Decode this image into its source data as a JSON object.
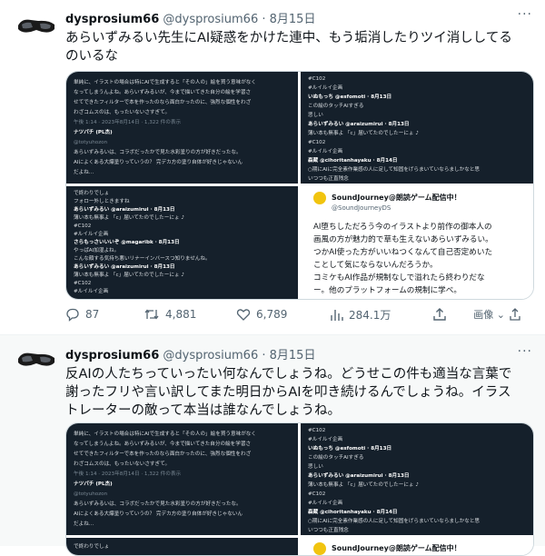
{
  "tweets": [
    {
      "display_name": "dysprosium66",
      "handle": "@dysprosium66",
      "dot": "·",
      "date": "8月15日",
      "more": "···",
      "text_lines": [
        "あらいずみるい先生にAI疑惑をかけた連中、もう垢消したりツイ消ししてる",
        "のいるな"
      ],
      "media": {
        "top_left": [
          {
            "t": "単純に、イラストの場合は特にAIで生成すると「その人の」絵を買う意味がなく",
            "c": ""
          },
          {
            "t": "なってしまうんよね。あらいずみるいが、今まで描いてきた自分の絵を学習さ",
            "c": ""
          },
          {
            "t": "せてできたフィルターで本を作ったのなら面白かったのに、強烈な個性をわざ",
            "c": ""
          },
          {
            "t": "わざコムスのは、もったいないさすぎて。",
            "c": ""
          },
          {
            "t": "午後 1:14 · 2023年8月14日 · 1,322 件の表示",
            "c": "dim"
          },
          {
            "t": "ナツパチ (PL杰)",
            "c": "bold"
          },
          {
            "t": "@totyuhozon",
            "c": "dim"
          },
          {
            "t": "あらいずみるいは、コラボだったかで見た水彩塗りの方が好きだったな。",
            "c": ""
          },
          {
            "t": "AIによくある大爆塗りっていうの？ 完デカ方の塗り自体が好きじゃないん",
            "c": ""
          },
          {
            "t": "だよね…",
            "c": ""
          }
        ],
        "top_right": [
          {
            "t": "#C102",
            "c": ""
          },
          {
            "t": "#ルイルイ企画",
            "c": ""
          },
          {
            "t": "いぬもっち @esfomoti · 8月13日",
            "c": "bold"
          },
          {
            "t": "この絵のタッチAIすぎる",
            "c": ""
          },
          {
            "t": "悲しい",
            "c": ""
          },
          {
            "t": "あらいずみるい @araizumirui · 8月13日",
            "c": "bold"
          },
          {
            "t": "薄い本も無事よ 「c」届いてたのでしたーにょ ♪",
            "c": ""
          },
          {
            "t": "#C102",
            "c": ""
          },
          {
            "t": "#ルイルイ企画",
            "c": ""
          },
          {
            "t": "森蔵 @cihoritanhayaku · 8月14日",
            "c": "bold"
          },
          {
            "t": "○期にAIに完全素作業感の人に足して知固をげらまいていならましかなと思",
            "c": ""
          },
          {
            "t": "いつつも正直残念",
            "c": ""
          }
        ],
        "bottom_left": [
          {
            "t": "で終わりでしょ",
            "c": ""
          },
          {
            "t": "フォロー外しときますね",
            "c": ""
          },
          {
            "t": "あらいずみるい @araizumirui · 8月13日",
            "c": "bold"
          },
          {
            "t": "薄い本も無事よ 「c」届いてたのでしたーにょ ♪",
            "c": ""
          },
          {
            "t": "#C102",
            "c": ""
          },
          {
            "t": "#ルイルイ企画",
            "c": ""
          },
          {
            "t": "さらもっさいいいぞ @magaribk · 8月13日",
            "c": "bold"
          },
          {
            "t": "やっぱAI加湿よね。",
            "c": ""
          },
          {
            "t": "こんな顔する気持ち悪いリナーインバースつ知りませんね。",
            "c": ""
          },
          {
            "t": "あらいずみるい @araizumirui · 8月13日",
            "c": "bold"
          },
          {
            "t": "薄い本も無事よ 「c」届いてたのでしたーにょ ♪",
            "c": ""
          },
          {
            "t": "#C102",
            "c": ""
          },
          {
            "t": "#ルイルイ企画",
            "c": ""
          }
        ],
        "bottom_right": {
          "name": "SoundJourney@朗読ゲーム配信中！",
          "handle": "@SoundJourneyDS",
          "lines": [
            "AI堕ちしただろう今のイラストより前作の御本人の",
            "画風の方が魅力的で草も生えないあらいずみるい。",
            "つかAI使った方がいいねつくなんて自己否定めいた",
            "ことして気にならないんだろうか。",
            "コミケもAI作品が規制なしで溢れたら終わりだな",
            "ー。他のプラットフォームの規制に学べ。"
          ],
          "footer_name": "SoundJourney@朗読ゲーム配信中！"
        }
      },
      "actions": {
        "replies": "87",
        "retweets": "4,881",
        "likes": "6,789",
        "views": "284.1万",
        "image_button": "画像"
      }
    },
    {
      "display_name": "dysprosium66",
      "handle": "@dysprosium66",
      "dot": "·",
      "date": "8月15日",
      "more": "···",
      "text_lines": [
        "反AIの人たちっていったい何なんでしょうね。どうせこの件も適当な言葉で",
        "謝ったフリや言い訳してまた明日からAIを叩き続けるんでしょうね。イラス",
        "トレーターの敵って本当は誰なんでしょうね。"
      ],
      "media": {
        "top_left": [
          {
            "t": "単純に、イラストの場合は特にAIで生成すると「その人の」絵を買う意味がなく",
            "c": ""
          },
          {
            "t": "なってしまうんよね。あらいずみるいが、今まで描いてきた自分の絵を学習さ",
            "c": ""
          },
          {
            "t": "せてできたフィルターで本を作ったのなら面白かったのに、強烈な個性をわざ",
            "c": ""
          },
          {
            "t": "わざコムスのは、もったいないさすぎて。",
            "c": ""
          },
          {
            "t": "午後 1:14 · 2023年8月14日 · 1,322 件の表示",
            "c": "dim"
          },
          {
            "t": "ナツパチ (PL杰)",
            "c": "bold"
          },
          {
            "t": "@totyuhozon",
            "c": "dim"
          },
          {
            "t": "あらいずみるいは、コラボだったかで見た水彩塗りの方が好きだったな。",
            "c": ""
          },
          {
            "t": "AIによくある大爆塗りっていうの？ 完デカ方の塗り自体が好きじゃないん",
            "c": ""
          },
          {
            "t": "だよね…",
            "c": ""
          }
        ],
        "top_right": [
          {
            "t": "#C102",
            "c": ""
          },
          {
            "t": "#ルイルイ企画",
            "c": ""
          },
          {
            "t": "いぬもっち @esfomoti · 8月13日",
            "c": "bold"
          },
          {
            "t": "この絵のタッチAIすぎる",
            "c": ""
          },
          {
            "t": "悲しい",
            "c": ""
          },
          {
            "t": "あらいずみるい @araizumirui · 8月13日",
            "c": "bold"
          },
          {
            "t": "薄い本も無事よ 「c」届いてたのでしたーにょ ♪",
            "c": ""
          },
          {
            "t": "#C102",
            "c": ""
          },
          {
            "t": "#ルイルイ企画",
            "c": ""
          },
          {
            "t": "森蔵 @cihoritanhayaku · 8月14日",
            "c": "bold"
          },
          {
            "t": "○期にAIに完全素作業感の人に足して知固をげらまいていならましかなと思",
            "c": ""
          },
          {
            "t": "いつつも正直残念",
            "c": ""
          }
        ],
        "bottom_left": [
          {
            "t": "で終わりでしょ",
            "c": ""
          }
        ],
        "bottom_right_name": "SoundJourney@朗読ゲーム配信中！"
      }
    }
  ]
}
